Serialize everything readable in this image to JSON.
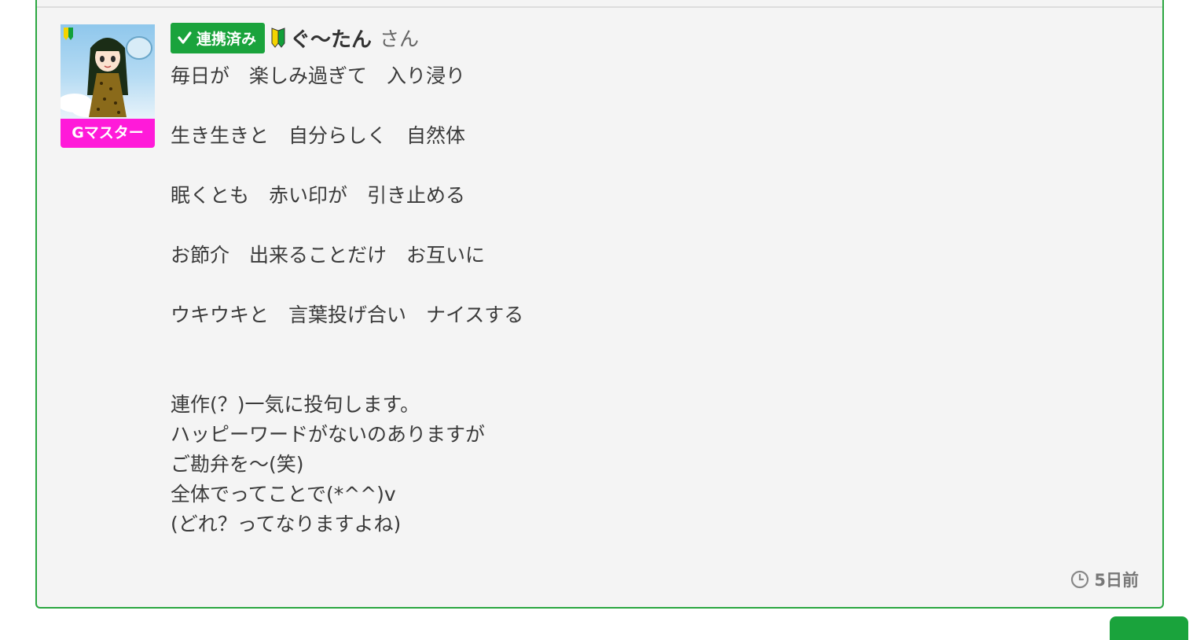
{
  "post": {
    "badge_linked": "連携済み",
    "username": "ぐ〜たん",
    "honorific": "さん",
    "rank_label": "Gマスター",
    "poem_lines": [
      "毎日が　楽しみ過ぎて　入り浸り",
      "生き生きと　自分らしく　自然体",
      "眠くとも　赤い印が　引き止める",
      "お節介　出来ることだけ　お互いに",
      "ウキウキと　言葉投げ合い　ナイスする"
    ],
    "note_lines": [
      "連作(？)一気に投句します。",
      "ハッピーワードがないのありますが",
      "ご勘弁を〜(笑)",
      "全体でってことで(*^^)v",
      "(どれ？ってなりますよね)"
    ],
    "timestamp": "5日前"
  },
  "icons": {
    "avatar": "user-avatar",
    "beginner_mark": "beginner-leaf-icon",
    "linked_check": "check-icon",
    "clock": "clock-icon"
  },
  "colors": {
    "border": "#2aa640",
    "linked_badge": "#1aa33c",
    "rank_badge": "#ff1ad9",
    "card_bg": "#f4f4f4"
  }
}
